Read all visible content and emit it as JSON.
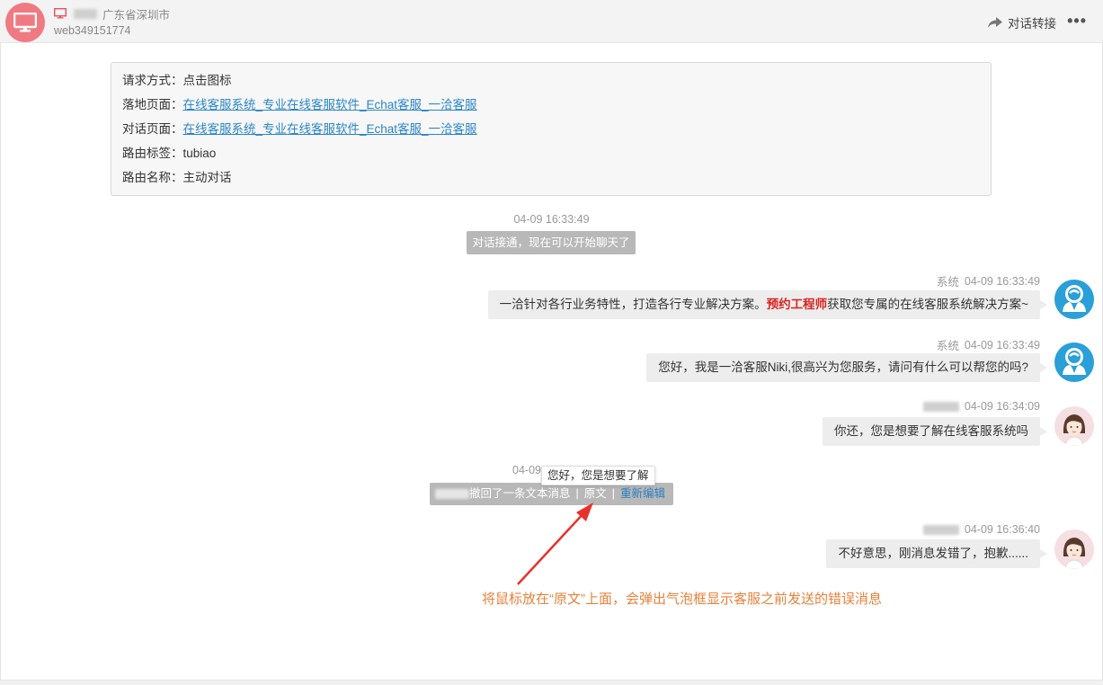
{
  "header": {
    "location": "广东省深圳市",
    "visitor_id": "web349151774",
    "transfer_label": "对话转接",
    "more_label": "•••"
  },
  "info_card": {
    "rows": [
      {
        "label": "请求方式：",
        "value": "点击图标",
        "link": false
      },
      {
        "label": "落地页面：",
        "value": "在线客服系统_专业在线客服软件_Echat客服_一洽客服",
        "link": true
      },
      {
        "label": "对话页面：",
        "value": "在线客服系统_专业在线客服软件_Echat客服_一洽客服",
        "link": true
      },
      {
        "label": "路由标签：",
        "value": "tubiao",
        "link": false
      },
      {
        "label": "路由名称：",
        "value": "主动对话",
        "link": false
      }
    ]
  },
  "conversation": {
    "start_time": "04-09 16:33:49",
    "start_notice": "对话接通，现在可以开始聊天了",
    "messages": [
      {
        "sender": "系统",
        "time": "04-09 16:33:49",
        "text_before": "一洽针对各行业务特性，打造各行专业解决方案。",
        "highlight": "预约工程师",
        "text_after": "获取您专属的在线客服系统解决方案~",
        "avatar": "agent-avatar"
      },
      {
        "sender": "系统",
        "time": "04-09 16:33:49",
        "text": "您好，我是一洽客服Niki,很高兴为您服务，请问有什么可以帮您的吗?",
        "avatar": "agent-avatar"
      },
      {
        "sender": "",
        "time": "04-09 16:34:09",
        "text": "你还，您是想要了解在线客服系统吗",
        "avatar": "visitor-avatar"
      },
      {
        "sender": "",
        "time": "04-09 16:36:40",
        "text": "不好意思，刚消息发错了，抱歉......",
        "avatar": "visitor-avatar"
      }
    ],
    "recall": {
      "time": "04-09",
      "text": "撤回了一条文本消息",
      "original_label": "原文",
      "reedit_label": "重新编辑",
      "tooltip": "您好，您是想要了解"
    }
  },
  "annotation": "将鼠标放在“原文”上面，会弹出气泡框显示客服之前发送的错误消息",
  "colors": {
    "accent": "#2a86c9",
    "highlight": "#d9231f",
    "annotation": "#e8813a",
    "header_avatar": "#f07a82",
    "agent_avatar": "#2a9fd8"
  }
}
